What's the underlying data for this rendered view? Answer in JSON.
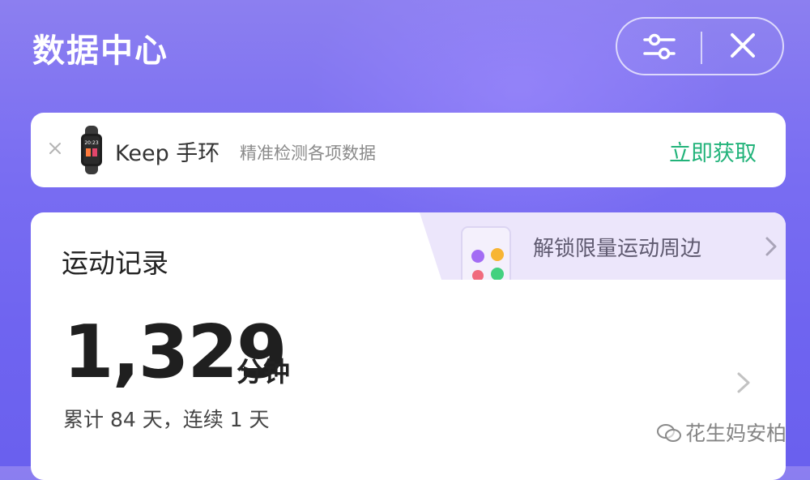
{
  "header": {
    "title": "数据中心",
    "actions": {
      "settings_icon": "sliders-icon",
      "close_icon": "close-icon"
    }
  },
  "promo": {
    "dismiss_icon": "close-icon",
    "product_icon": "fitness-band-icon",
    "brand": "Keep 手环",
    "description": "精准检测各项数据",
    "cta": "立即获取",
    "cta_color": "#22b37a"
  },
  "record": {
    "title": "运动记录",
    "unlock": {
      "label": "解锁限量运动周边",
      "icon": "phone-stickers-icon"
    },
    "total": "1,329",
    "unit": "分钟",
    "summary": "累计 84 天，连续 1 天"
  },
  "watermark": {
    "text": "花生妈安柏"
  },
  "colors": {
    "background": "#7a6ef2",
    "accent_green": "#22b37a",
    "unlock_tab": "#ece6fb"
  }
}
